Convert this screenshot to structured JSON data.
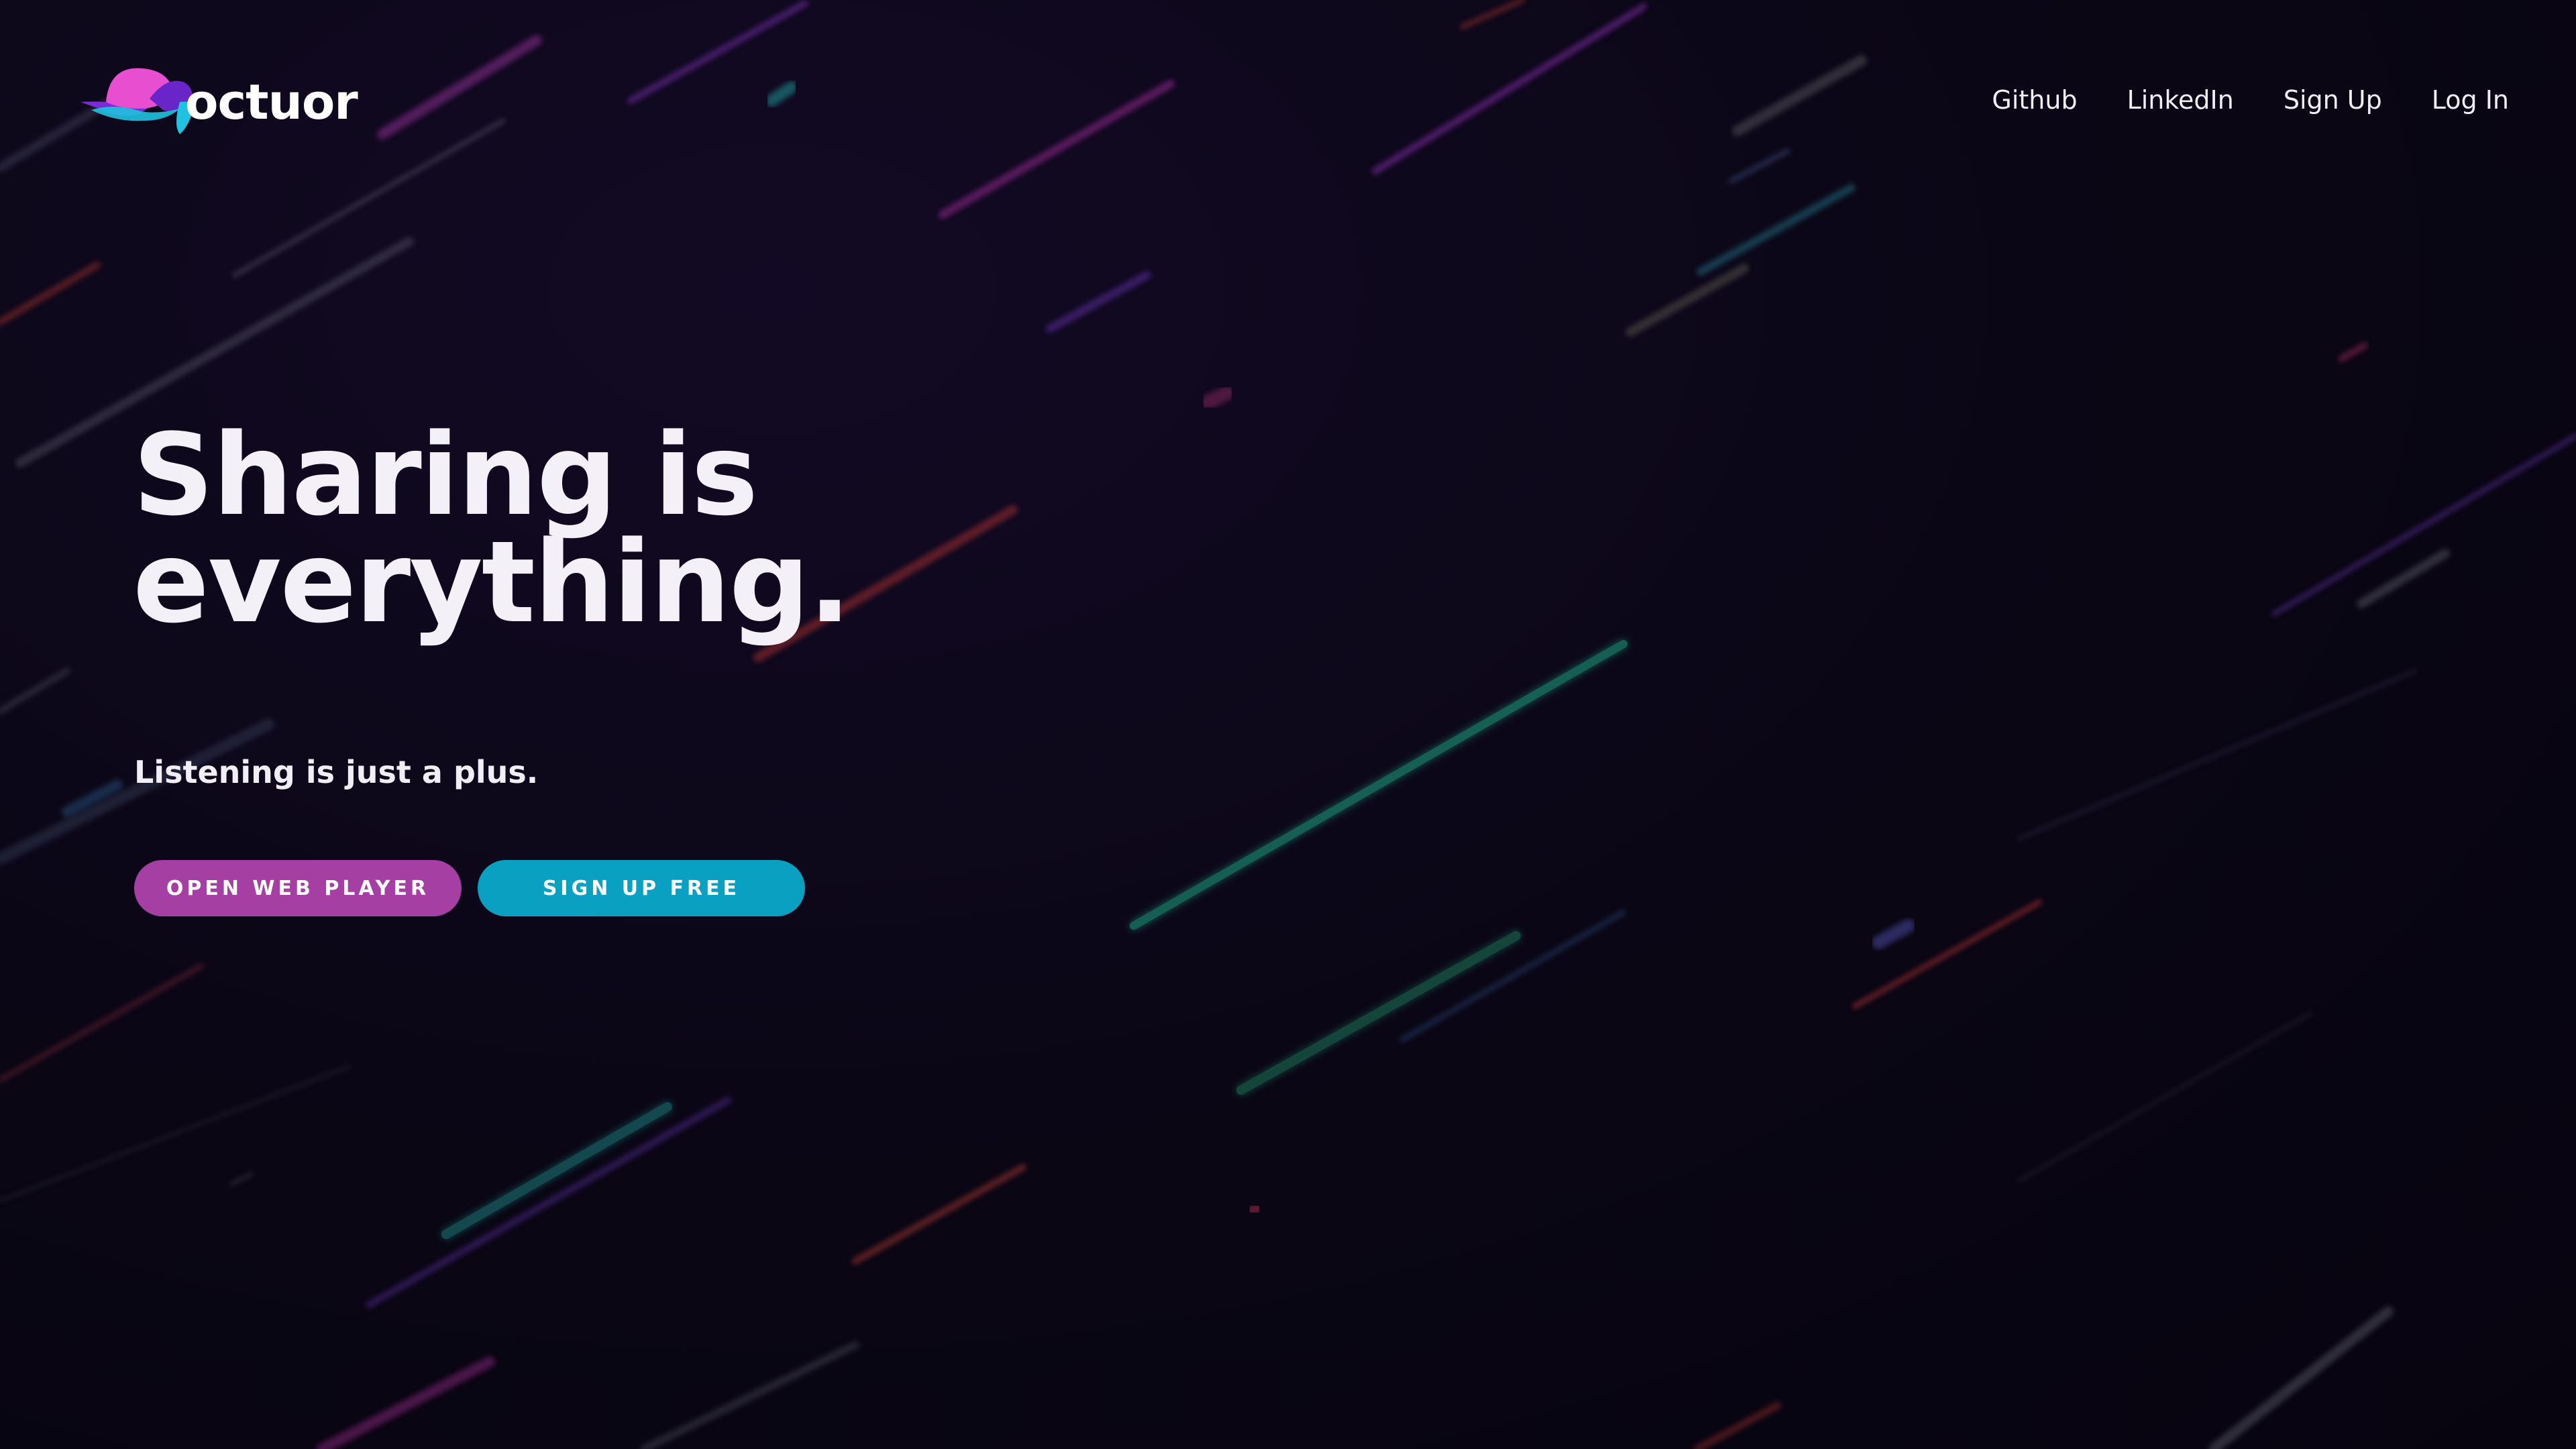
{
  "brand": {
    "name": "octuor",
    "colors": {
      "pink": "#e84fd0",
      "purple": "#7a2bd6",
      "cyan": "#1fc3e0",
      "background": "#0a0614"
    }
  },
  "nav": {
    "items": [
      {
        "label": "Github"
      },
      {
        "label": "LinkedIn"
      },
      {
        "label": "Sign Up"
      },
      {
        "label": "Log In"
      }
    ]
  },
  "hero": {
    "title_line1": "Sharing is",
    "title_line2": "everything.",
    "subtitle": "Listening is just a plus.",
    "primary_button": {
      "label": "OPEN WEB PLAYER",
      "color": "#a63fa3"
    },
    "secondary_button": {
      "label": "SIGN UP FREE",
      "color": "#0aa0c2"
    }
  }
}
